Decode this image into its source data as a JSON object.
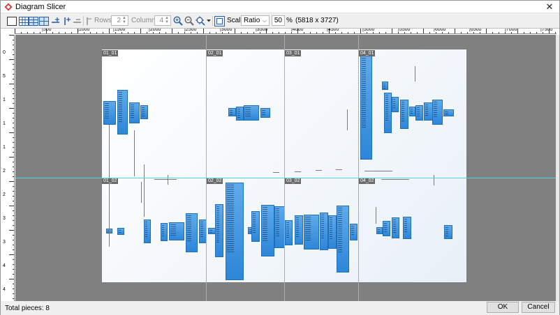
{
  "window": {
    "title": "Diagram Slicer",
    "close_glyph": "✕"
  },
  "toolbar": {
    "layout_buttons": [
      "single-piece-icon",
      "grid-icon",
      "grid-wide-icon",
      "grid-large-icon"
    ],
    "rows_label": "Rows :",
    "rows_value": "2",
    "columns_label": "Columns :",
    "columns_value": "4",
    "scale_label": "Scale :",
    "scale_value": "Ratio",
    "zoom_value": "50",
    "percent_sign": "%",
    "dimensions": "(5818 x 3727)"
  },
  "ruler": {
    "h_marks": [
      "|500",
      "|1000",
      "|1500",
      "|2000",
      "|2500",
      "|3000",
      "|3500",
      "|4000",
      "|4500",
      "|5000",
      "|5500",
      "|6000",
      "|6500",
      "|7000",
      "|7500"
    ],
    "v_marks": [
      "0",
      "5",
      "1",
      "1",
      "1",
      "2",
      "2",
      "3",
      "3",
      "4",
      "4"
    ]
  },
  "slices": [
    "01_01",
    "02_01",
    "03_01",
    "04_01",
    "01_02",
    "02_02",
    "03_02",
    "04_02"
  ],
  "colors": {
    "guide": "#4fd5d8",
    "block": "#3a8fdc",
    "viewport": "#808080"
  },
  "status": {
    "total_pieces": "Total pieces: 8"
  },
  "buttons": {
    "ok": "OK",
    "cancel": "Cancel"
  }
}
